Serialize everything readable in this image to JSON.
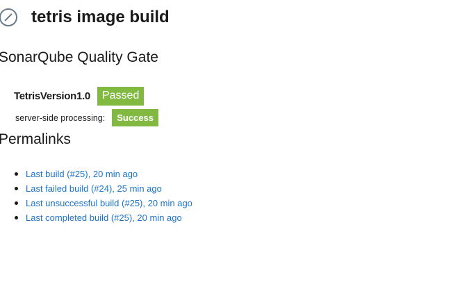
{
  "header": {
    "title": "tetris image build",
    "icon": "disabled-status-icon"
  },
  "sonarqube": {
    "heading": "SonarQube Quality Gate",
    "project_name": "TetrisVersion1.0",
    "gate_status": "Passed",
    "processing_label": "server-side processing:",
    "processing_status": "Success",
    "status_color": "#82b941"
  },
  "permalinks": {
    "heading": "Permalinks",
    "items": [
      {
        "label": "Last build (#25), 20 min ago"
      },
      {
        "label": "Last failed build (#24), 25 min ago"
      },
      {
        "label": "Last unsuccessful build (#25), 20 min ago"
      },
      {
        "label": "Last completed build (#25), 20 min ago"
      }
    ],
    "link_color": "#1a73c8"
  }
}
